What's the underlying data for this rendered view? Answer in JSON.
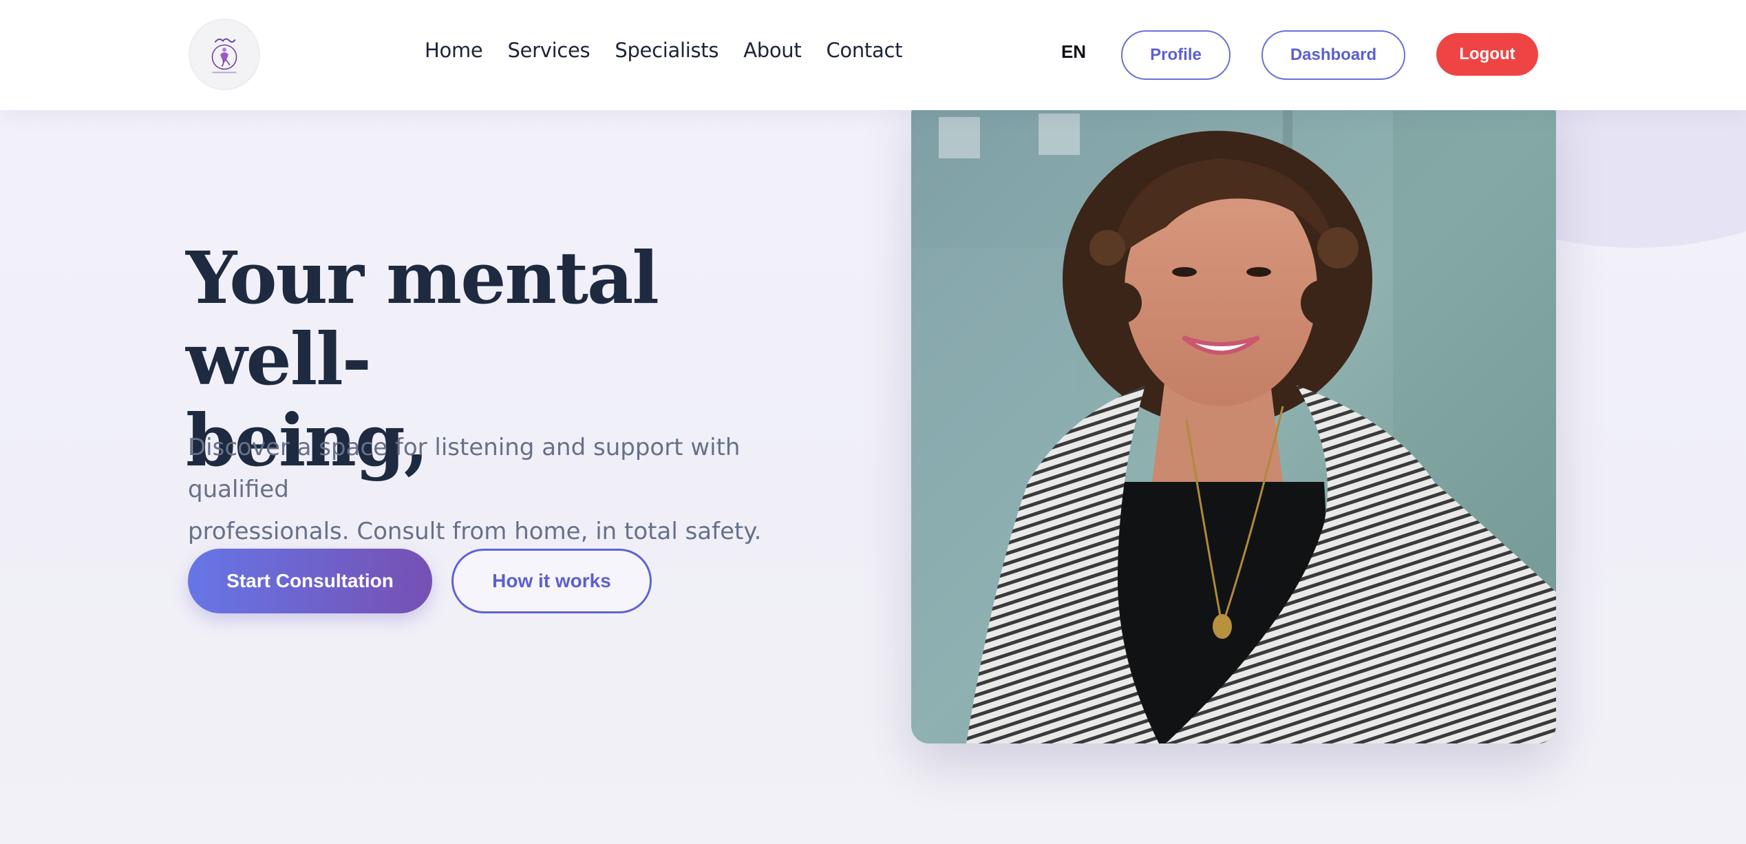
{
  "header": {
    "nav": [
      {
        "label": "Home"
      },
      {
        "label": "Services"
      },
      {
        "label": "Specialists"
      },
      {
        "label": "About"
      },
      {
        "label": "Contact"
      }
    ],
    "language": "EN",
    "profile_label": "Profile",
    "dashboard_label": "Dashboard",
    "logout_label": "Logout"
  },
  "hero": {
    "title_line1": "Your mental well-",
    "title_line2": "being,",
    "subtitle_line1": "Discover a space for listening and support with qualified",
    "subtitle_line2": "professionals. Consult from home, in total safety.",
    "primary_cta": "Start Consultation",
    "secondary_cta": "How it works"
  },
  "colors": {
    "accent": "#5f63d4",
    "gradient_start": "#6676e6",
    "gradient_end": "#7650b3",
    "logout": "#ef4444",
    "heading": "#1e2a40",
    "body_text": "#667089",
    "background": "#f1f0f8"
  },
  "icons": {
    "logo": "brand-logo-icon"
  }
}
